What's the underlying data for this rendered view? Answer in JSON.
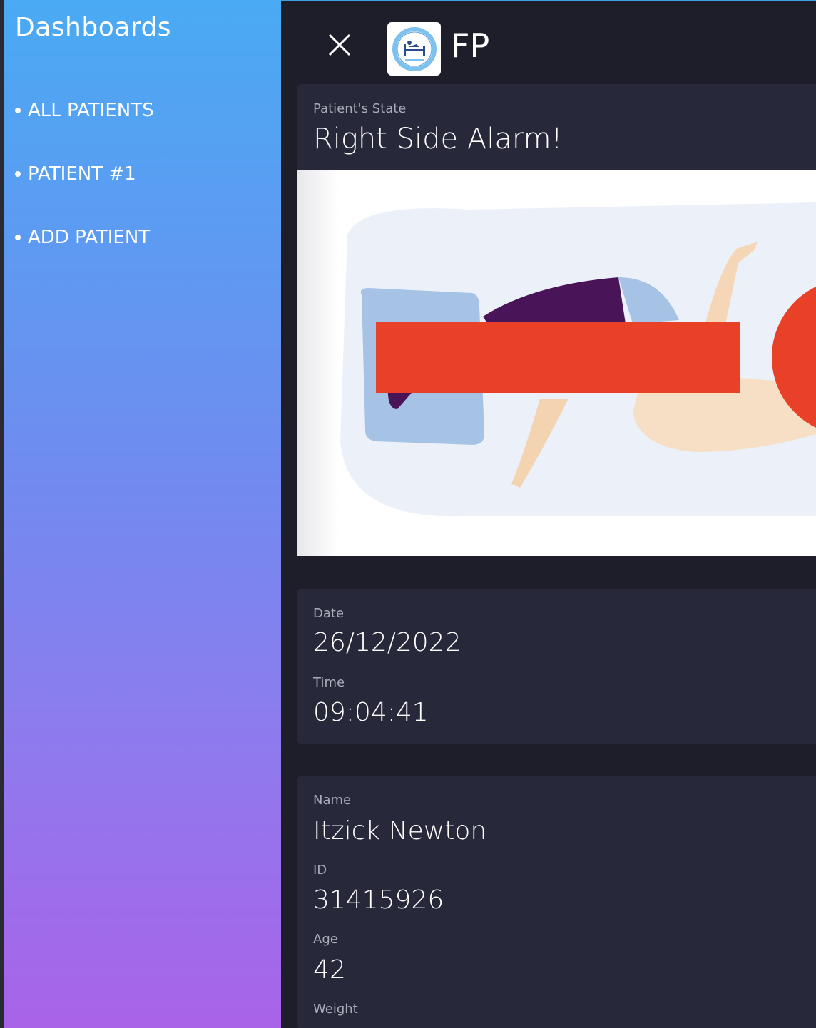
{
  "sidebar": {
    "title": "Dashboards",
    "items": [
      {
        "label": "ALL PATIENTS"
      },
      {
        "label": "PATIENT #1"
      },
      {
        "label": "ADD PATIENT"
      }
    ]
  },
  "header": {
    "close_icon": "close-icon",
    "logo_icon": "fall-prevention-logo",
    "logo_text": "FP"
  },
  "state_card": {
    "label": "Patient's State",
    "value": "Right Side Alarm!",
    "alarm_color": "#e94127"
  },
  "datetime_card": {
    "date_label": "Date",
    "date_value": "26/12/2022",
    "time_label": "Time",
    "time_value": "09:04:41"
  },
  "patient_card": {
    "name_label": "Name",
    "name_value": "Itzick Newton",
    "id_label": "ID",
    "id_value": "31415926",
    "age_label": "Age",
    "age_value": "42",
    "weight_label": "Weight"
  },
  "colors": {
    "sidebar_top": "#4aaaf3",
    "sidebar_bottom": "#a963e9",
    "background": "#1e1e2b",
    "card": "#272839"
  }
}
